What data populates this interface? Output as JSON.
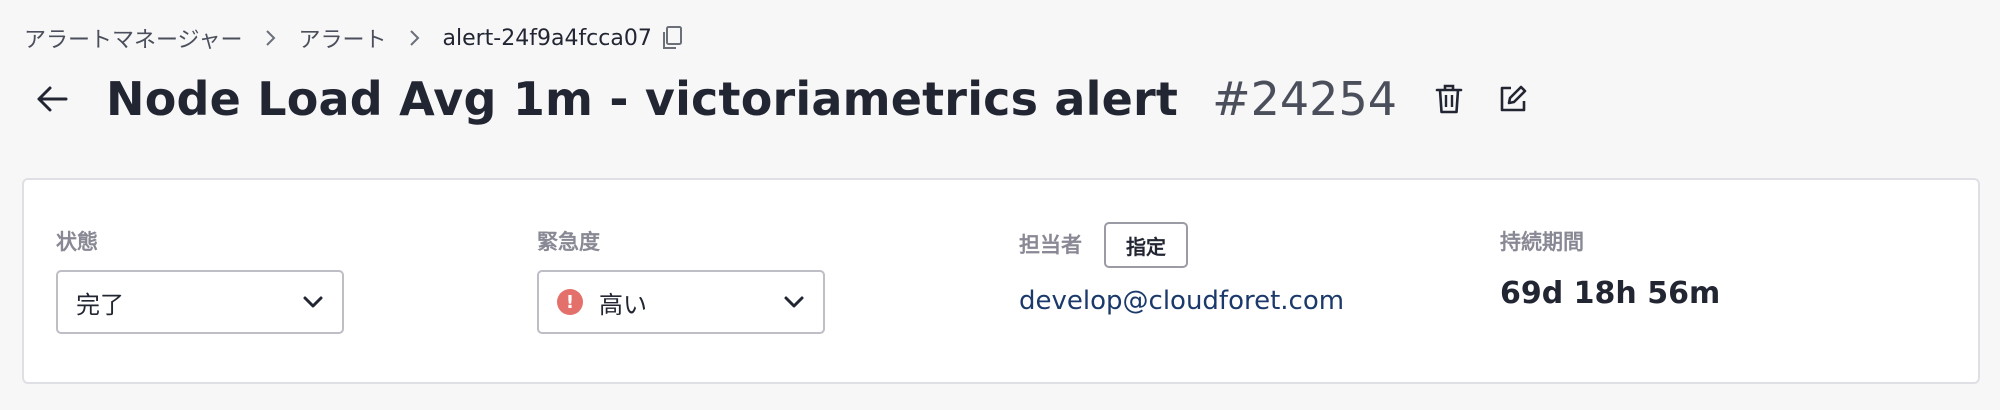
{
  "breadcrumb": {
    "items": [
      "アラートマネージャー",
      "アラート"
    ],
    "current": "alert-24f9a4fcca07"
  },
  "header": {
    "title": "Node Load Avg 1m - victoriametrics alert",
    "alert_number": "#24254"
  },
  "details": {
    "state": {
      "label": "状態",
      "value": "完了"
    },
    "urgency": {
      "label": "緊急度",
      "value": "高い",
      "icon_glyph": "!",
      "icon_color": "#e4706b"
    },
    "assignee": {
      "label": "担当者",
      "assign_button": "指定",
      "value": "develop@cloudforet.com"
    },
    "duration": {
      "label": "持続期間",
      "value": "69d 18h 56m"
    }
  },
  "colors": {
    "background": "#f7f7f7",
    "card": "#ffffff",
    "label": "#898995",
    "link": "#1b3a6b",
    "urgency_high": "#e4706b"
  },
  "icons": {
    "back": "arrow-left-icon",
    "copy": "copy-icon",
    "delete": "trash-icon",
    "edit": "edit-icon",
    "separator": "chevron-right-icon",
    "dropdown": "chevron-down-icon",
    "urgency": "exclamation-circle-icon"
  }
}
